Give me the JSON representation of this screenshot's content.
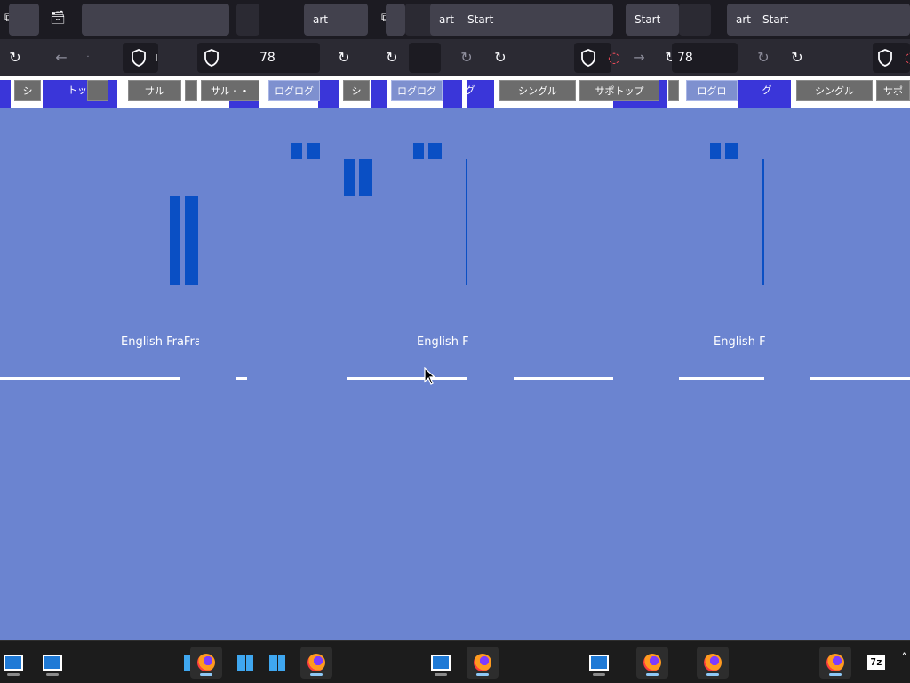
{
  "browser": {
    "tabs": [
      {
        "label": ""
      },
      {
        "label": ""
      },
      {
        "label": "art"
      },
      {
        "label": "art"
      },
      {
        "label": "Start"
      },
      {
        "label": "Start"
      },
      {
        "label": "art"
      },
      {
        "label": "Start"
      }
    ],
    "url_fragments": [
      "78",
      "78"
    ],
    "url_stub": "ı",
    "url_dot": "·"
  },
  "site_menu": {
    "items": [
      "シ",
      "トッ",
      "サル",
      "サル・・",
      "ログログ",
      "シ",
      "ログログ",
      "グ",
      "シングル",
      "サポトップ",
      "ログロ",
      "グ",
      "シングル",
      "サポ"
    ]
  },
  "content": {
    "captions": [
      "English FraFrar",
      "English Fr",
      "English Fr"
    ]
  },
  "taskbar": {
    "items": [
      "explorer",
      "explorer",
      "windows-start",
      "firefox",
      "windows-start",
      "windows-start",
      "firefox",
      "explorer",
      "firefox",
      "explorer",
      "firefox",
      "firefox",
      "firefox",
      "7zip"
    ],
    "sevenzip_label": "7z"
  },
  "colors": {
    "page_bg": "#6b84d0",
    "menu_band": "#3a36d9",
    "bars": "#0a4fc4",
    "taskbar": "#1c1c1c",
    "tabstrip": "#1c1b22",
    "navbar": "#2b2a33"
  }
}
